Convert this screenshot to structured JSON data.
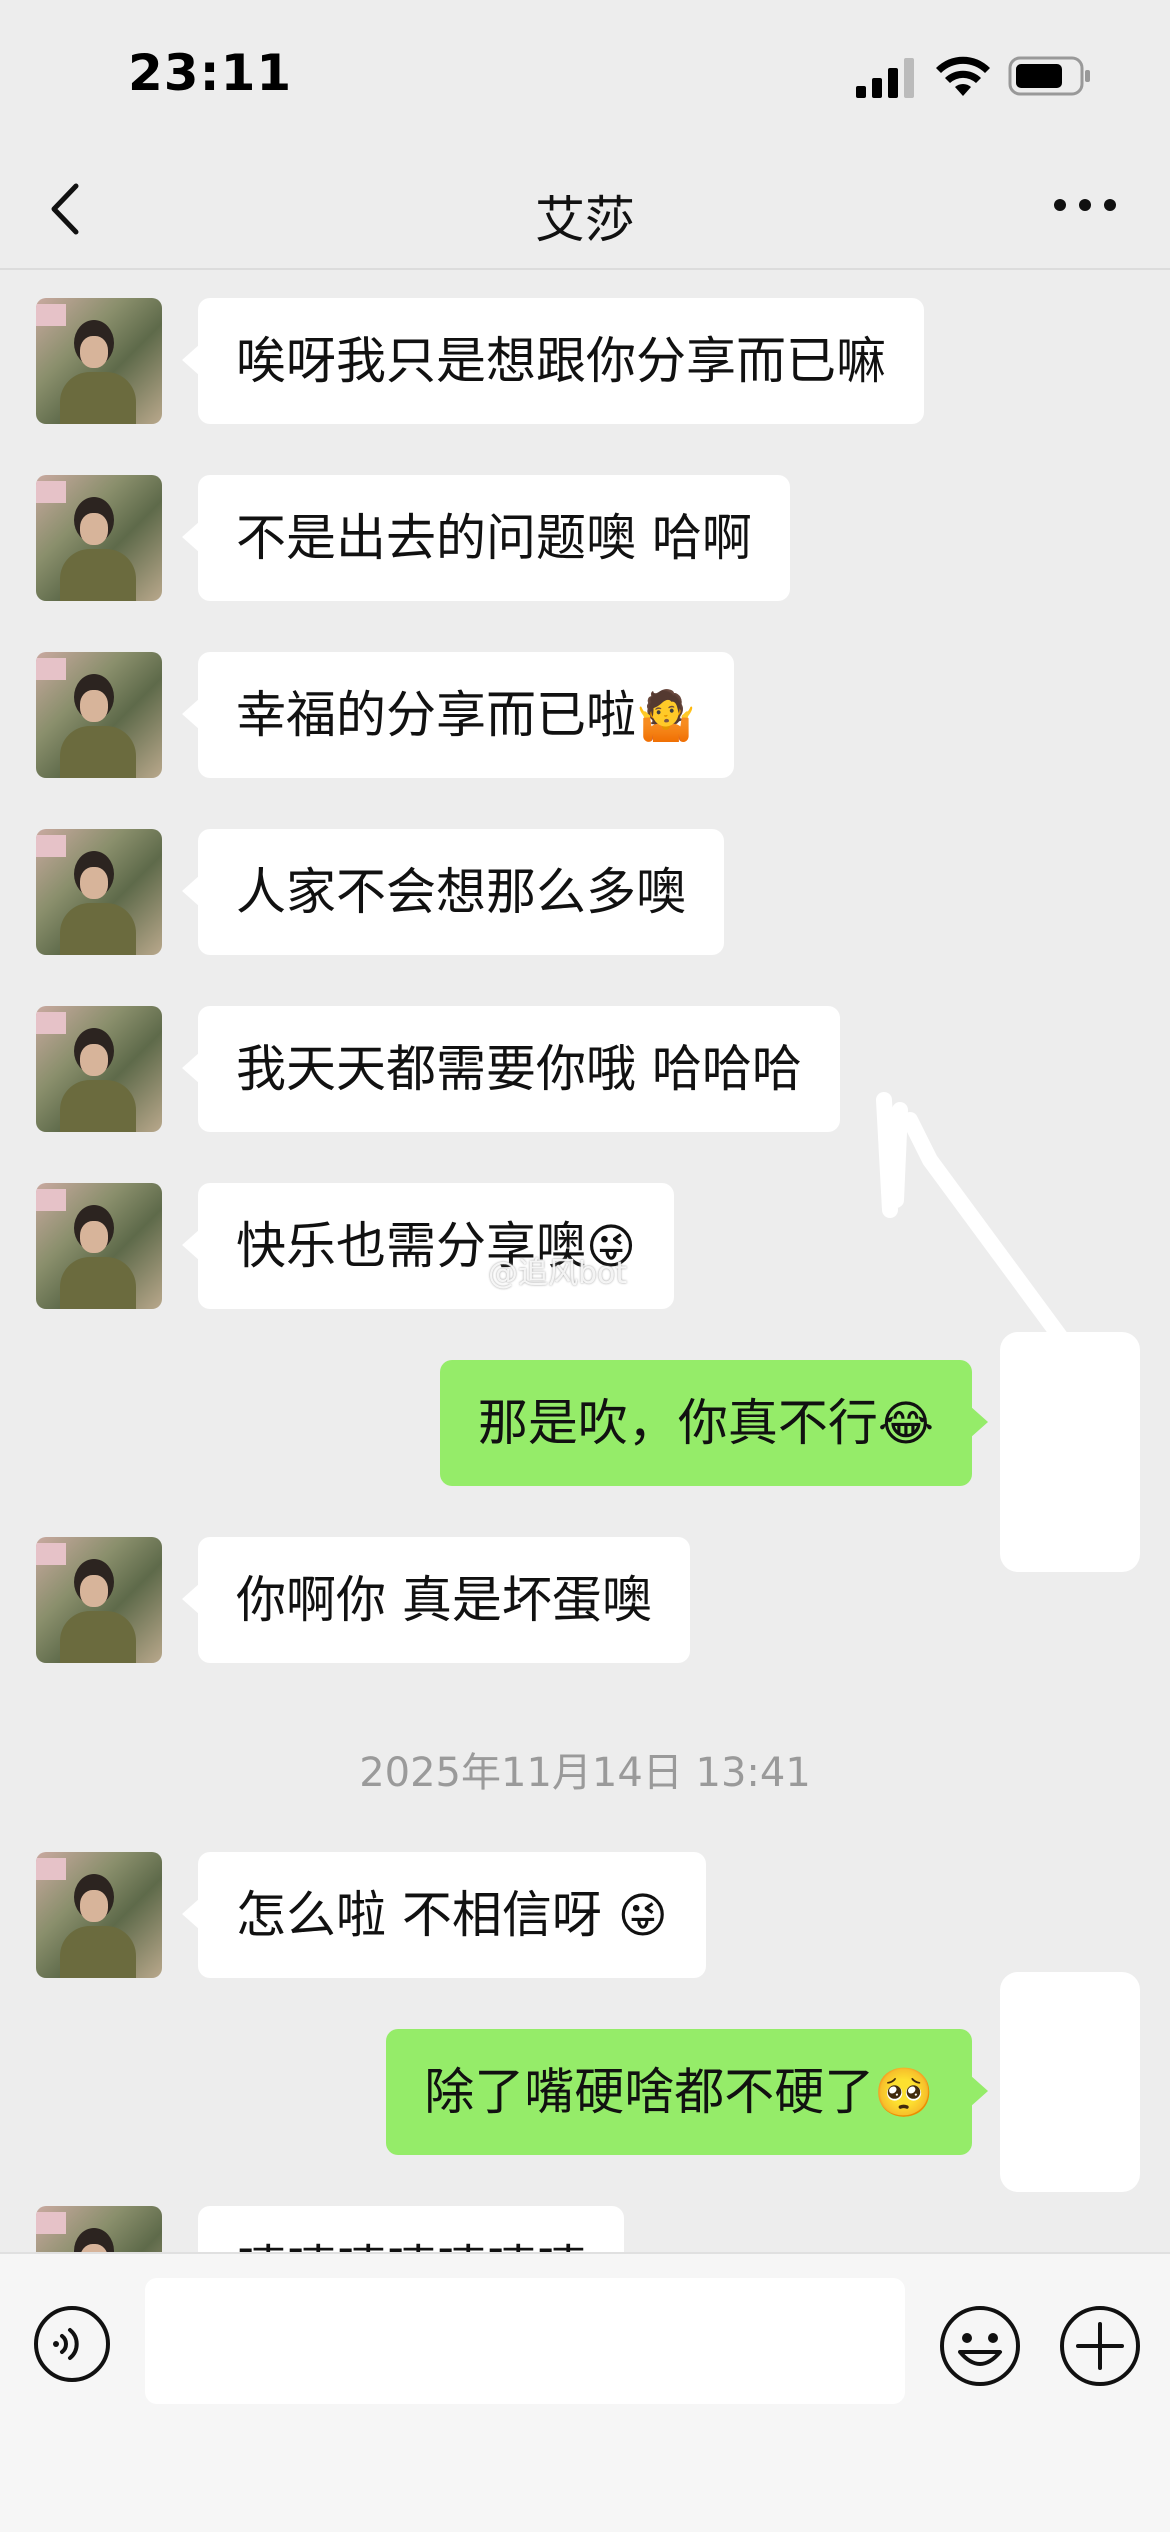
{
  "status_bar": {
    "time": "23:11"
  },
  "nav": {
    "title": "艾莎"
  },
  "messages": [
    {
      "side": "in",
      "text": "唉呀我只是想跟你分享而已嘛"
    },
    {
      "side": "in",
      "text": "不是出去的问题噢 哈啊"
    },
    {
      "side": "in",
      "text": "幸福的分享而已啦",
      "emoji": "🤷"
    },
    {
      "side": "in",
      "text": "人家不会想那么多噢"
    },
    {
      "side": "in",
      "text": "我天天都需要你哦 哈哈哈"
    },
    {
      "side": "in",
      "text": "快乐也需分享噢",
      "emoji": "😜"
    },
    {
      "side": "out",
      "text": "那是吹，你真不行",
      "emoji": "😂"
    },
    {
      "side": "in",
      "text": "你啊你 真是坏蛋噢"
    },
    {
      "side": "in",
      "text": "怎么啦 不相信呀 ",
      "emoji": "😜"
    },
    {
      "side": "out",
      "text": "除了嘴硬啥都不硬了",
      "emoji": "🥺"
    },
    {
      "side": "in",
      "text": "嘻嘻嘻嘻嘻嘻嘻"
    }
  ],
  "timestamp": "2025年11月14日 13:41",
  "watermark": "@追风bot",
  "colors": {
    "background": "#ededed",
    "incoming_bubble": "#ffffff",
    "outgoing_bubble": "#95ec69"
  },
  "icons": [
    "back-icon",
    "more-icon",
    "voice-icon",
    "emoji-icon",
    "plus-icon",
    "signal-icon",
    "wifi-icon",
    "battery-icon"
  ]
}
